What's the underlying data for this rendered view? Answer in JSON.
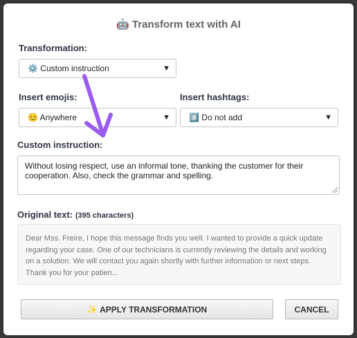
{
  "dialog": {
    "title_icon": "🤖",
    "title": "Transform text with AI"
  },
  "transformation": {
    "label": "Transformation:",
    "icon": "⚙️",
    "value": "Custom instruction"
  },
  "emojis": {
    "label": "Insert emojis:",
    "icon": "😊",
    "value": "Anywhere"
  },
  "hashtags": {
    "label": "Insert hashtags:",
    "icon": "#️⃣",
    "value": "Do not add"
  },
  "custom_instruction": {
    "label": "Custom instruction:",
    "value": "Without losing respect, use an informal tone, thanking the customer for their cooperation. Also, check the grammar and spelling."
  },
  "original_text": {
    "label": "Original text:",
    "count": "(395 characters)",
    "preview": "Dear Mss. Freire, I hope this message finds you well. I wanted to provide a quick update regarding your case. One of our technicians is currently reviewing the details and working on a solution. We will contact you again shortly with further information or next steps. Thank you for your patien..."
  },
  "actions": {
    "apply_icon": "✨",
    "apply_label": "APPLY TRANSFORMATION",
    "cancel_label": "CANCEL"
  },
  "annotation": {
    "arrow_color": "#9b5cf0"
  }
}
